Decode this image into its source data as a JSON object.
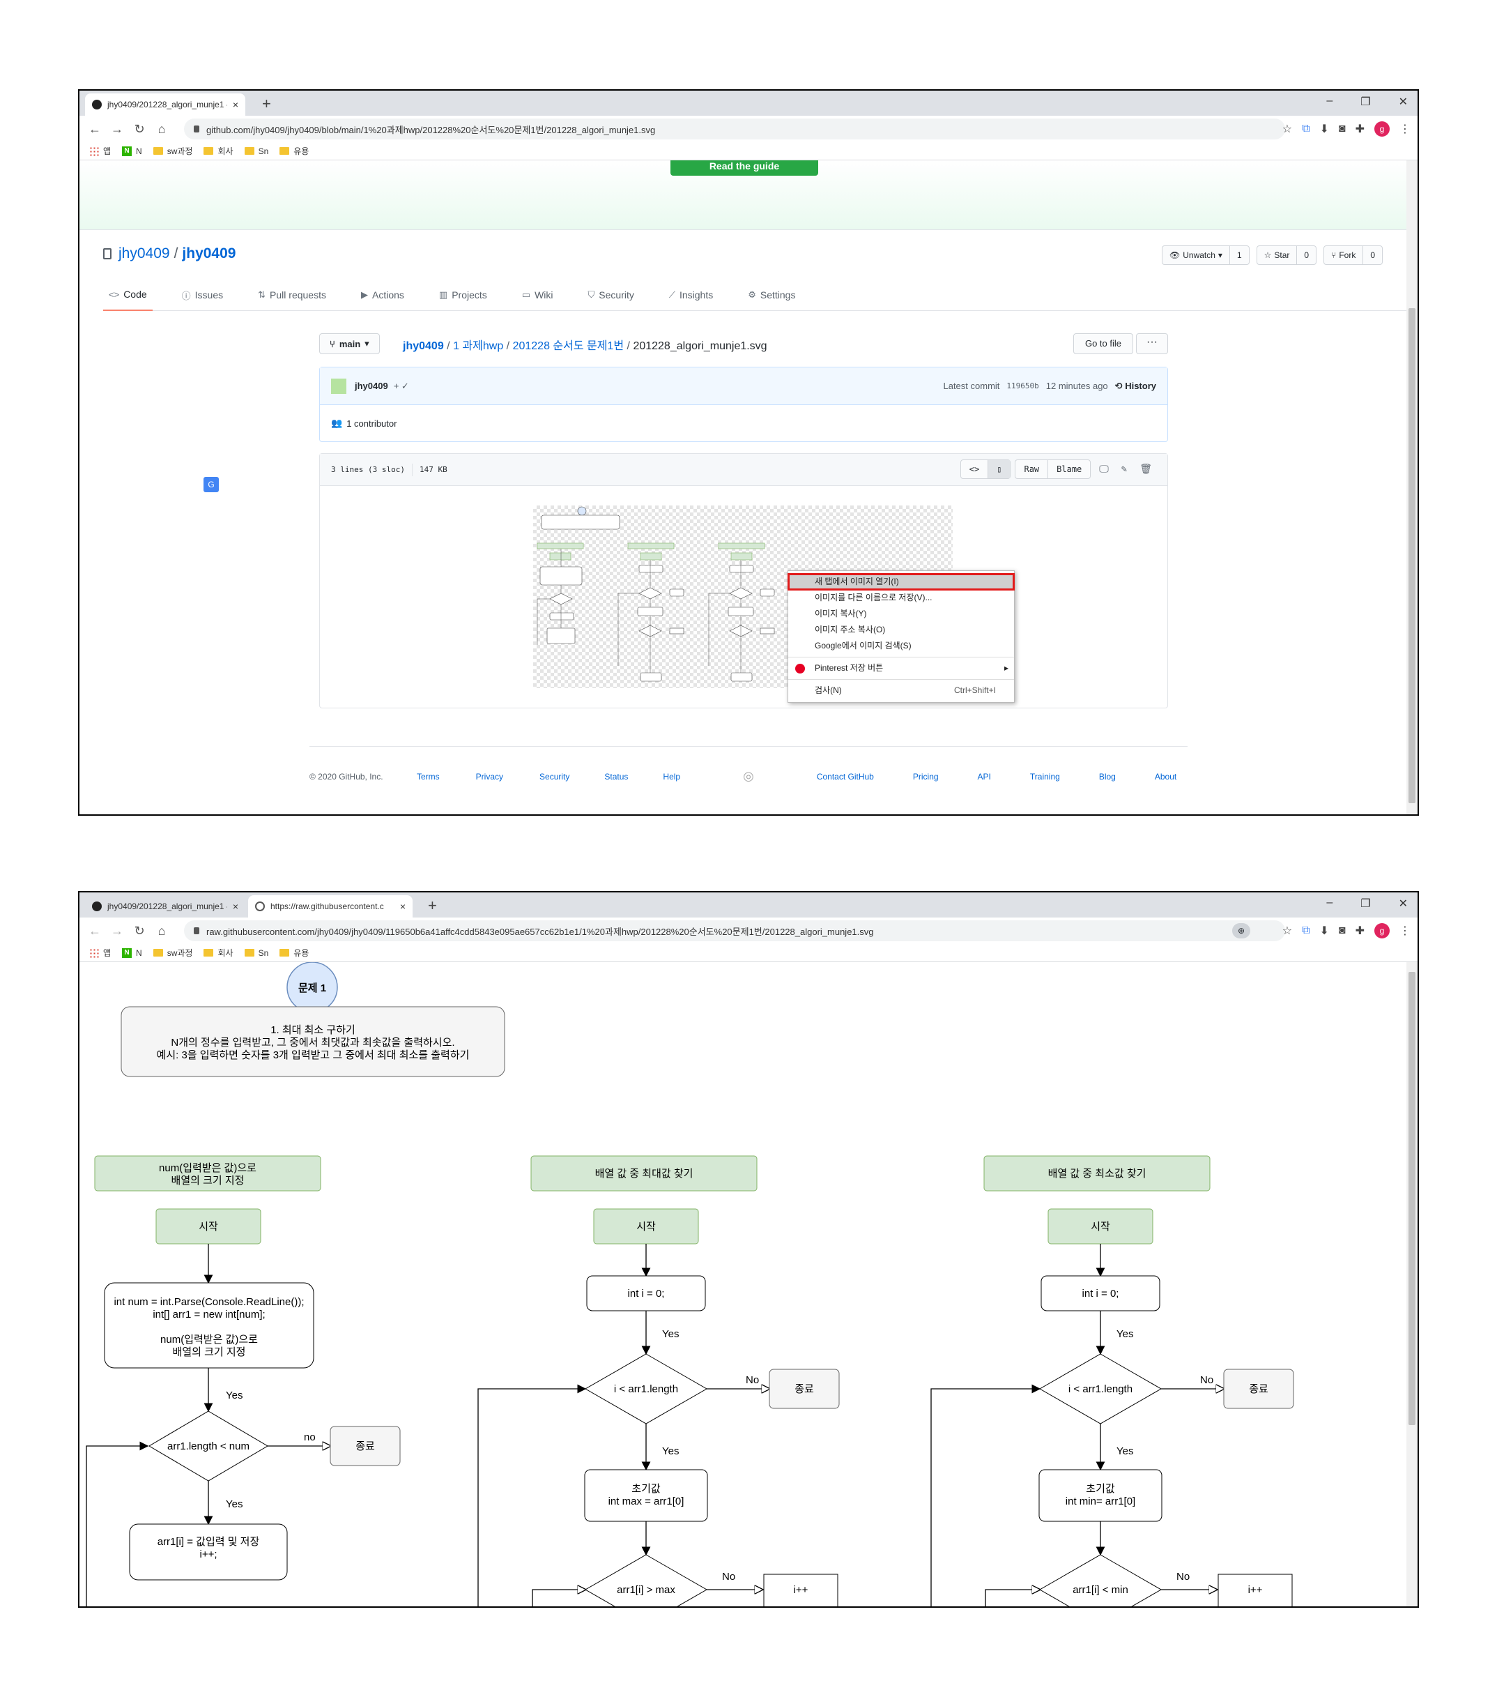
{
  "shot1": {
    "tab_title": "jhy0409/201228_algori_munje1 -",
    "tab_close": "×",
    "new_tab": "+",
    "window_controls": [
      "–",
      "❐",
      "✕"
    ],
    "url": "github.com/jhy0409/jhy0409/blob/main/1%20과제hwp/201228%20순서도%20문제1번/201228_algori_munje1.svg",
    "bookmarks": [
      "앱",
      "N",
      "sw과정",
      "회사",
      "Sn",
      "유용"
    ],
    "guide_button": "Read the guide",
    "repo_owner": "jhy0409",
    "repo_sep": "/",
    "repo_name": "jhy0409",
    "unwatch_label": "Unwatch",
    "unwatch_count": "1",
    "star_label": "Star",
    "star_count": "0",
    "fork_label": "Fork",
    "fork_count": "0",
    "nav": [
      {
        "label": "Code",
        "icon": "<>"
      },
      {
        "label": "Issues",
        "icon": "ⓘ"
      },
      {
        "label": "Pull requests",
        "icon": "⇅"
      },
      {
        "label": "Actions",
        "icon": "▶"
      },
      {
        "label": "Projects",
        "icon": "▥"
      },
      {
        "label": "Wiki",
        "icon": "▭"
      },
      {
        "label": "Security",
        "icon": "⛉"
      },
      {
        "label": "Insights",
        "icon": "⟋"
      },
      {
        "label": "Settings",
        "icon": "⚙"
      }
    ],
    "branch": "main",
    "breadcrumb": {
      "owner": "jhy0409",
      "folder1": "1 과제hwp",
      "folder2": "201228 순서도 문제1번",
      "file": "201228_algori_munje1.svg",
      "sep": "/"
    },
    "goto_file": "Go to file",
    "more": "···",
    "commit": {
      "author": "jhy0409",
      "plus": "+ ✓",
      "latest_label": "Latest commit",
      "hash": "119650b",
      "time": "12 minutes ago",
      "history": "History"
    },
    "contributors": "1 contributor",
    "file_lines": "3 lines (3 sloc)",
    "file_size": "147 KB",
    "raw": "Raw",
    "blame": "Blame",
    "context_menu": [
      {
        "label": "새 탭에서 이미지 열기(I)",
        "shortcut": ""
      },
      {
        "label": "이미지를 다른 이름으로 저장(V)...",
        "shortcut": ""
      },
      {
        "label": "이미지 복사(Y)",
        "shortcut": ""
      },
      {
        "label": "이미지 주소 복사(O)",
        "shortcut": ""
      },
      {
        "label": "Google에서 이미지 검색(S)",
        "shortcut": ""
      },
      {
        "label": "Pinterest 저장 버튼",
        "shortcut": ""
      },
      {
        "label": "검사(N)",
        "shortcut": "Ctrl+Shift+I"
      }
    ],
    "footer": {
      "copyright": "© 2020 GitHub, Inc.",
      "links": [
        "Terms",
        "Privacy",
        "Security",
        "Status",
        "Help",
        "Contact GitHub",
        "Pricing",
        "API",
        "Training",
        "Blog",
        "About"
      ]
    }
  },
  "shot2": {
    "tab1_title": "jhy0409/201228_algori_munje1 -",
    "tab2_title": "https://raw.githubusercontent.c",
    "url": "raw.githubusercontent.com/jhy0409/jhy0409/119650b6a41affc4cdd5843e095ae657cc62b1e1/1%20과제hwp/201228%20순서도%20문제1번/201228_algori_munje1.svg",
    "diagram": {
      "title_circle": "문제 1",
      "problem": [
        "1. 최대 최소 구하기",
        "N개의 정수를 입력받고, 그 중에서 최댓값과 최솟값을 출력하시오.",
        "예시: 3을 입력하면 숫자를 3개 입력받고 그 중에서 최대 최소를 출력하기"
      ],
      "col1_header": [
        "num(입력받은 값)으로",
        "배열의 크기 지정"
      ],
      "col2_header": "배열 값 중 최대값 찾기",
      "col3_header": "배열 값 중 최소값 찾기",
      "start": "시작",
      "col1_process": [
        "int num = int.Parse(Console.ReadLine());",
        "int[] arr1 = new int[num];",
        "",
        "num(입력받은 값)으로",
        "배열의 크기 지정"
      ],
      "col1_cond": "arr1.length < num",
      "col1_no": "no",
      "end": "종료",
      "yes": "Yes",
      "No": "No",
      "col1_input": [
        "arr1[i] = 값입력 및 저장",
        "i++;"
      ],
      "init_i": "int i = 0;",
      "loop_cond": "i < arr1.length",
      "col2_init": [
        "초기값",
        "int max = arr1[0]"
      ],
      "col3_init": [
        "초기값",
        "int min= arr1[0]"
      ],
      "col2_cmp": "arr1[i] > max",
      "col3_cmp": "arr1[i] < min",
      "inc": "i++"
    }
  }
}
